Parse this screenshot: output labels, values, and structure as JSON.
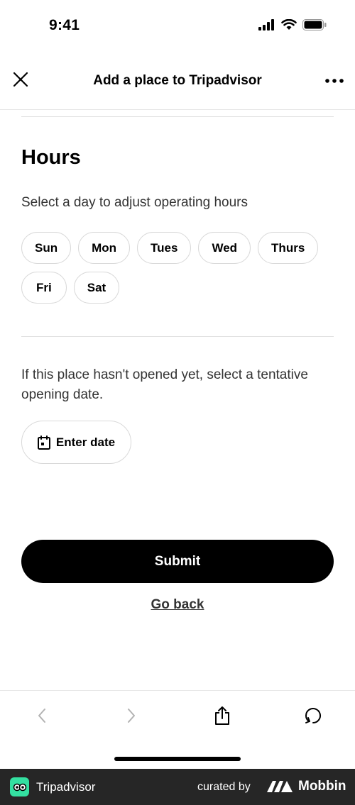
{
  "status_bar": {
    "time": "9:41"
  },
  "nav": {
    "title": "Add a place to Tripadvisor"
  },
  "hours": {
    "title": "Hours",
    "subtitle": "Select a day to adjust operating hours",
    "days": [
      "Sun",
      "Mon",
      "Tues",
      "Wed",
      "Thurs",
      "Fri",
      "Sat"
    ]
  },
  "opening": {
    "text": "If this place hasn't opened yet, select a tentative opening date.",
    "date_button_label": "Enter date"
  },
  "actions": {
    "submit_label": "Submit",
    "go_back_label": "Go back"
  },
  "footer": {
    "app_name": "Tripadvisor",
    "curated_by": "curated by",
    "brand": "Mobbin"
  },
  "colors": {
    "primary": "#000000",
    "chip_border": "#d9d9d9",
    "footer_bg": "#262626",
    "tripadvisor_green": "#34e0a1"
  }
}
